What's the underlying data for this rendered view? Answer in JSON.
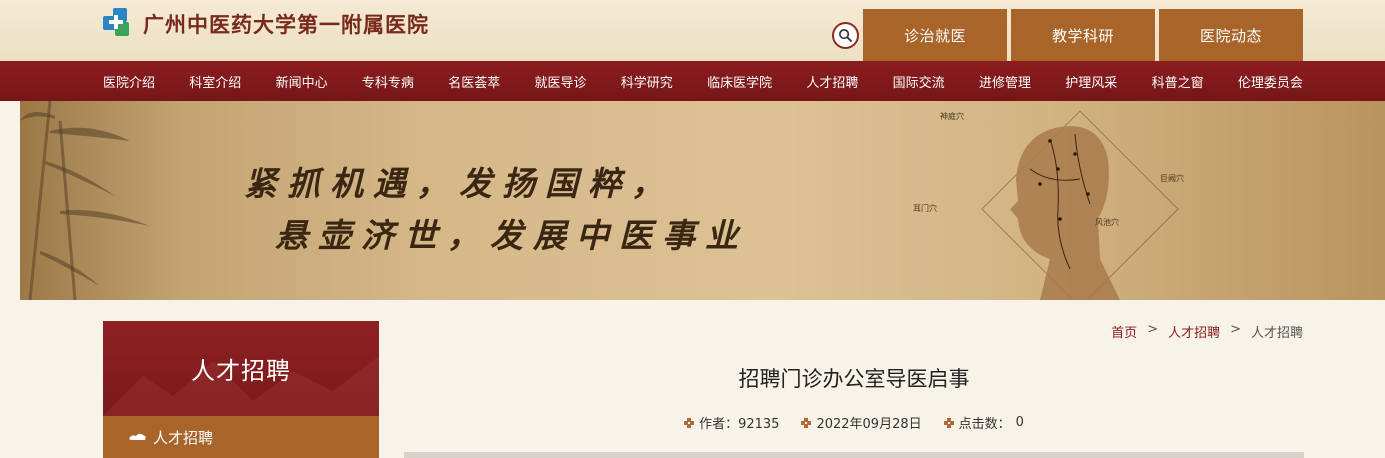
{
  "header": {
    "hospital_name": "广州中医药大学第一附属医院",
    "top_tabs": [
      "诊治就医",
      "教学科研",
      "医院动态"
    ]
  },
  "nav": {
    "items": [
      "医院介绍",
      "科室介绍",
      "新闻中心",
      "专科专病",
      "名医荟萃",
      "就医导诊",
      "科学研究",
      "临床医学院",
      "人才招聘",
      "国际交流",
      "进修管理",
      "护理风采",
      "科普之窗",
      "伦理委员会"
    ]
  },
  "banner": {
    "slogan_line1": "紧抓机遇，发扬国粹，",
    "slogan_line2": "悬壶济世，发展中医事业",
    "acupoints": [
      "神庭穴",
      "耳门穴",
      "巨阙穴",
      "风池穴"
    ]
  },
  "sidebar": {
    "title": "人才招聘",
    "items": [
      "人才招聘"
    ]
  },
  "breadcrumb": {
    "items": [
      "首页",
      "人才招聘",
      "人才招聘"
    ],
    "separator": ">"
  },
  "article": {
    "title": "招聘门诊办公室导医启事",
    "author_label": "作者：92135",
    "date": "2022年09月28日",
    "clicks_label": "点击数：",
    "clicks": "0"
  },
  "colors": {
    "nav_red": "#8b1d1f",
    "tab_brown": "#a9642a",
    "background": "#f7f3e9"
  }
}
